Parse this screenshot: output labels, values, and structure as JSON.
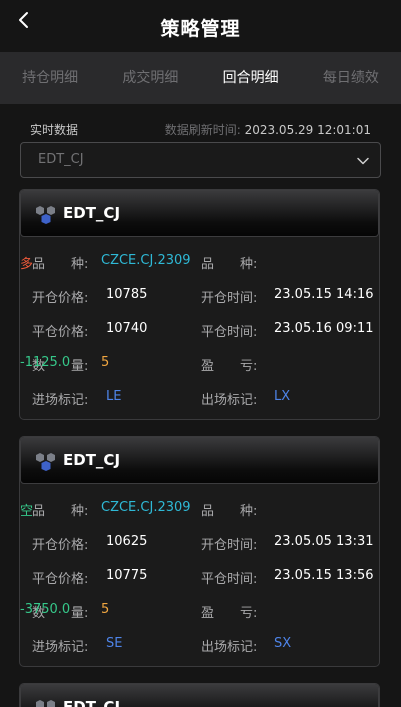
{
  "header": {
    "title": "策略管理"
  },
  "tabs": [
    {
      "label": "持仓明细",
      "active": false
    },
    {
      "label": "成交明细",
      "active": false
    },
    {
      "label": "回合明细",
      "active": true
    },
    {
      "label": "每日绩效",
      "active": false
    }
  ],
  "meta": {
    "left_label": "实时数据",
    "refresh_label": "数据刷新时间:",
    "refresh_time": "2023.05.29 12:01:01"
  },
  "select": {
    "value": "EDT_CJ"
  },
  "labels": {
    "variety": "品　　种:",
    "direction": "品　　种:",
    "open_price": "开仓价格:",
    "open_time": "开仓时间:",
    "close_price": "平仓价格:",
    "close_time": "平仓时间:",
    "qty": "数　　量:",
    "pnl": "盈　　亏:",
    "entry_tag": "进场标记:",
    "exit_tag": "出场标记:"
  },
  "cards": [
    {
      "name": "EDT_CJ",
      "variety": "CZCE.CJ.2309",
      "direction": "多",
      "open_price": "10785",
      "open_time": "23.05.15 14:16",
      "close_price": "10740",
      "close_time": "23.05.16 09:11",
      "qty": "5",
      "pnl": "-1125.0",
      "entry_tag": "LE",
      "exit_tag": "LX"
    },
    {
      "name": "EDT_CJ",
      "variety": "CZCE.CJ.2309",
      "direction": "空",
      "open_price": "10625",
      "open_time": "23.05.05 13:31",
      "close_price": "10775",
      "close_time": "23.05.15 13:56",
      "qty": "5",
      "pnl": "-3750.0",
      "entry_tag": "SE",
      "exit_tag": "SX"
    },
    {
      "name": "EDT_CJ"
    }
  ],
  "colors": {
    "long": "#ef5a3a",
    "short": "#36c88a",
    "variety": "#2fb9d6",
    "qty": "#f0a641",
    "tag": "#4e84e8"
  }
}
